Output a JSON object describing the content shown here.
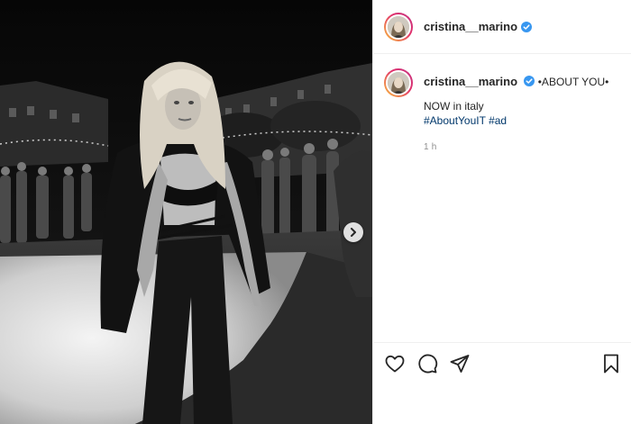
{
  "post": {
    "username": "cristina__marino",
    "verified": true,
    "caption": {
      "title": "•ABOUT YOU•",
      "line": "NOW in italy",
      "hashtags": [
        "#AboutYouIT",
        "#ad"
      ]
    },
    "timestamp": "1 h"
  },
  "icons": {
    "next": "chevron-right-icon",
    "like": "heart-icon",
    "comment": "comment-icon",
    "share": "paper-plane-icon",
    "save": "bookmark-icon",
    "verified": "verified-badge-icon"
  },
  "colors": {
    "verified": "#3897f0",
    "hashtag": "#00376b",
    "timestamp": "#8e8e8e",
    "divider": "#efefef"
  }
}
